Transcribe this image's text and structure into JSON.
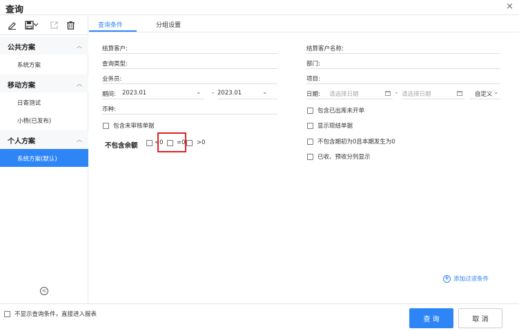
{
  "window": {
    "title": "查询",
    "close_label": "×"
  },
  "toolbar": {
    "icons": [
      "edit-icon",
      "save-icon",
      "chevron-down-icon",
      "export-icon",
      "delete-icon"
    ]
  },
  "sidebar": {
    "groups": [
      {
        "title": "公共方案",
        "items": [
          "系统方案"
        ]
      },
      {
        "title": "移动方案",
        "items": [
          "日寄测试",
          "小杨(已发布)"
        ]
      },
      {
        "title": "个人方案",
        "items": [
          "系统方案(默认)"
        ]
      }
    ],
    "active_item": "系统方案(默认)",
    "collapse_label": "<"
  },
  "tabs": [
    "查询条件",
    "分组设置"
  ],
  "form": {
    "settle_customer": "结算客户:",
    "query_type": "查询类型:",
    "salesperson": "业务员:",
    "period_label": "期间:",
    "period_start": "2023.01",
    "period_sep": "-",
    "period_end": "2023.01",
    "currency": "币种:",
    "include_unaudited": "包含未审核单据",
    "exclude_balance": "不包含余额",
    "bal_lt0": "<0",
    "bal_eq0": "=0",
    "bal_gt0": ">0",
    "settle_customer_name": "结算客户名称:",
    "department": "部门:",
    "project": "项目:",
    "date_label": "日期:",
    "date_placeholder_start": "请选择日期",
    "date_sep": "-",
    "date_placeholder_end": "请选择日期",
    "date_custom": "自定义",
    "include_outbound_uninvoiced": "包含已出库未开单",
    "show_cash_docs": "显示现结单据",
    "exclude_zero": "不包含期初为0且本期发生为0",
    "received_split": "已收、预收分列显示"
  },
  "add_filter": "添加过滤条件",
  "footer": {
    "skip_checkbox": "不显示查询条件，直接进入报表",
    "query_button": "查 询",
    "cancel_button": "取 消"
  },
  "colors": {
    "accent": "#2e86f6",
    "highlight": "#e02020"
  }
}
